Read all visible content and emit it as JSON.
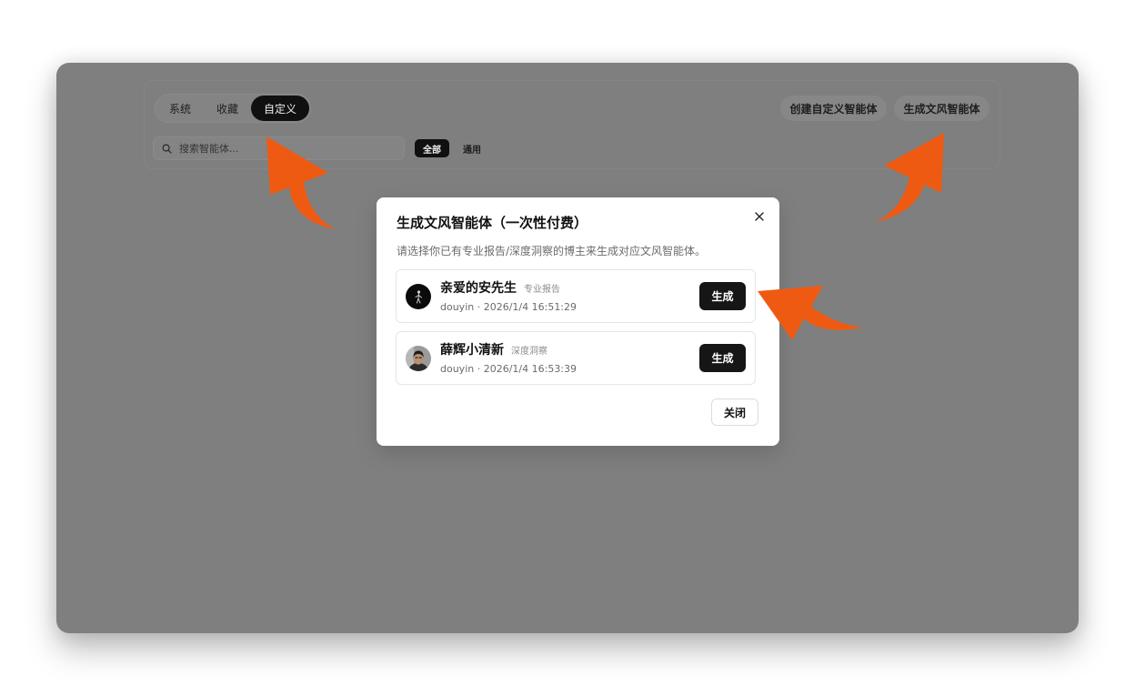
{
  "tabs": [
    {
      "label": "系统",
      "selected": false
    },
    {
      "label": "收藏",
      "selected": false
    },
    {
      "label": "自定义",
      "selected": true
    }
  ],
  "header_actions": {
    "create_label": "创建自定义智能体",
    "generate_label": "生成文风智能体"
  },
  "search": {
    "placeholder": "搜索智能体..."
  },
  "filters": [
    {
      "label": "全部",
      "selected": true
    },
    {
      "label": "通用",
      "selected": false
    }
  ],
  "modal": {
    "title": "生成文风智能体（一次性付费）",
    "description": "请选择你已有专业报告/深度洞察的博主来生成对应文风智能体。",
    "items": [
      {
        "name": "亲爱的安先生",
        "tag": "专业报告",
        "meta": "douyin · 2026/1/4 16:51:29",
        "action_label": "生成"
      },
      {
        "name": "薛辉小清新",
        "tag": "深度洞察",
        "meta": "douyin · 2026/1/4 16:53:39",
        "action_label": "生成"
      }
    ],
    "close_label": "关闭"
  },
  "icons": {
    "search": "search-icon",
    "close": "close-icon",
    "avatar": "avatar-icon",
    "annotation": "arrow-icon"
  },
  "colors": {
    "page_bg": "#ffffff",
    "overlay": "#7f7f7f",
    "dim_surface": "#848484",
    "dim_button": "#878787",
    "dim_border": "#8b8b8b",
    "dim_text": "#1e1e1e",
    "dim_placeholder": "#353535",
    "dark": "#101010",
    "modal_bg": "#ffffff",
    "modal_border": "#e6e6e6",
    "text_primary": "#111111",
    "text_secondary": "#6b6b6b",
    "text_muted": "#8c8c8c",
    "button_dark": "#161616",
    "annotation": "#ef5a12"
  }
}
